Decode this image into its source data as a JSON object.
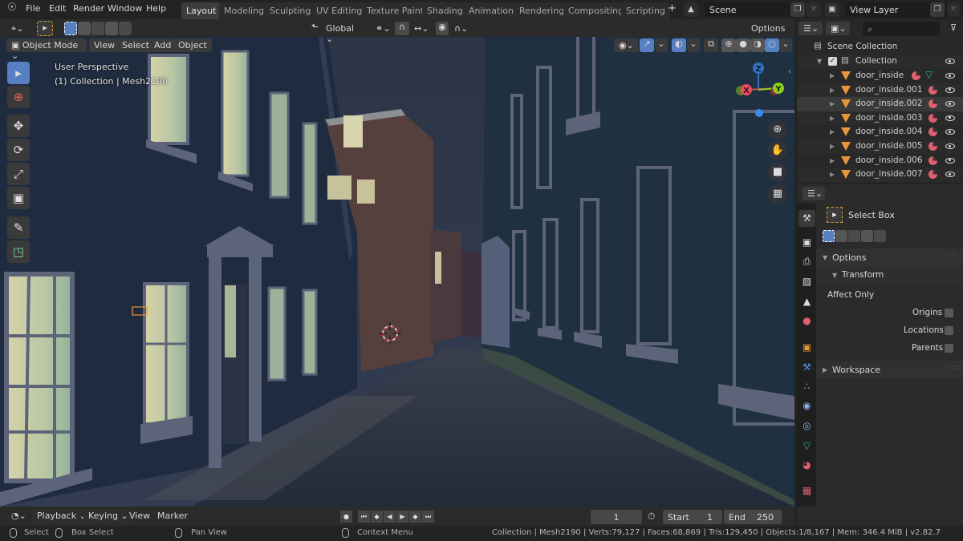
{
  "menus": [
    "File",
    "Edit",
    "Render",
    "Window",
    "Help"
  ],
  "workspaces": [
    {
      "label": "Layout",
      "active": true
    },
    {
      "label": "Modeling"
    },
    {
      "label": "Sculpting"
    },
    {
      "label": "UV Editing"
    },
    {
      "label": "Texture Paint"
    },
    {
      "label": "Shading"
    },
    {
      "label": "Animation"
    },
    {
      "label": "Rendering"
    },
    {
      "label": "Compositing"
    },
    {
      "label": "Scripting"
    }
  ],
  "add_workspace": "+",
  "scene": {
    "name": "Scene"
  },
  "view_layer": {
    "name": "View Layer"
  },
  "tool_header": {
    "orientation": "Global",
    "options_label": "Options"
  },
  "viewport_header": {
    "mode": "Object Mode",
    "menus": [
      "View",
      "Select",
      "Add",
      "Object"
    ]
  },
  "viewport_overlay": {
    "line1": "User Perspective",
    "line2": "(1) Collection | Mesh2190"
  },
  "gizmo": {
    "x": "X",
    "y": "Y",
    "z": "Z",
    "colors": {
      "x": "#f04a62",
      "y": "#8ad21a",
      "z": "#2f72c8"
    }
  },
  "outliner": {
    "search_placeholder": "",
    "root": "Scene Collection",
    "collection": "Collection",
    "items": [
      {
        "name": "door_inside",
        "has_mesh_data": true
      },
      {
        "name": "door_inside.001"
      },
      {
        "name": "door_inside.002",
        "selected": true
      },
      {
        "name": "door_inside.003"
      },
      {
        "name": "door_inside.004"
      },
      {
        "name": "door_inside.005"
      },
      {
        "name": "door_inside.006"
      },
      {
        "name": "door_inside.007"
      }
    ]
  },
  "properties": {
    "tool_name": "Select Box",
    "options_label": "Options",
    "transform_label": "Transform",
    "affect_only_label": "Affect Only",
    "checks": [
      {
        "label": "Origins",
        "checked": false
      },
      {
        "label": "Locations",
        "checked": false
      },
      {
        "label": "Parents",
        "checked": false
      }
    ],
    "workspace_label": "Workspace"
  },
  "timeline": {
    "menus": [
      "Playback",
      "Keying",
      "View",
      "Marker"
    ],
    "current_frame": "1",
    "start_label": "Start",
    "start": "1",
    "end_label": "End",
    "end": "250"
  },
  "statusbar": {
    "select": "Select",
    "box_select": "Box Select",
    "pan_view": "Pan View",
    "context_menu": "Context Menu",
    "stats": "Collection | Mesh2190 | Verts:79,127 | Faces:68,869 | Tris:129,450 | Objects:1/8,167 | Mem: 346.4 MiB | v2.82.7"
  },
  "colors": {
    "accent": "#5680c2",
    "mesh": "#e8963a",
    "material": "#e06070",
    "mesh_data": "#1fb88a"
  }
}
